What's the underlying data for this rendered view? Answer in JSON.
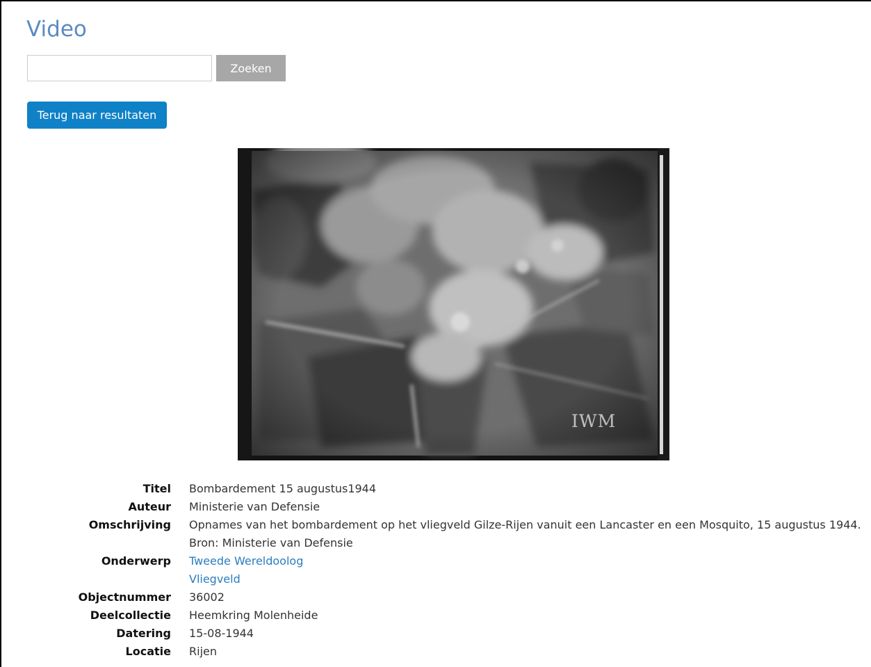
{
  "page": {
    "title": "Video"
  },
  "search": {
    "value": "",
    "placeholder": "",
    "button_label": "Zoeken"
  },
  "back_button": {
    "label": "Terug naar resultaten"
  },
  "video": {
    "watermark": "IWM"
  },
  "details": {
    "titel": {
      "label": "Titel",
      "value": "Bombardement 15 augustus1944"
    },
    "auteur": {
      "label": "Auteur",
      "value": "Ministerie van Defensie"
    },
    "omschrijving": {
      "label": "Omschrijving",
      "lines": [
        "Opnames van het bombardement op het vliegveld Gilze-Rijen vanuit een Lancaster en een Mosquito, 15 augustus 1944.",
        "Bron: Ministerie van Defensie"
      ]
    },
    "onderwerp": {
      "label": "Onderwerp",
      "links": [
        "Tweede Wereldoolog",
        "Vliegveld"
      ]
    },
    "objectnummer": {
      "label": "Objectnummer",
      "value": "36002"
    },
    "deelcollectie": {
      "label": "Deelcollectie",
      "value": "Heemkring Molenheide"
    },
    "datering": {
      "label": "Datering",
      "value": "15-08-1944"
    },
    "locatie": {
      "label": "Locatie",
      "value": "Rijen"
    }
  },
  "colors": {
    "title": "#5b8ac4",
    "link": "#2a7dbf",
    "primary_button": "#0f81c7",
    "search_button": "#a7a7a7"
  }
}
